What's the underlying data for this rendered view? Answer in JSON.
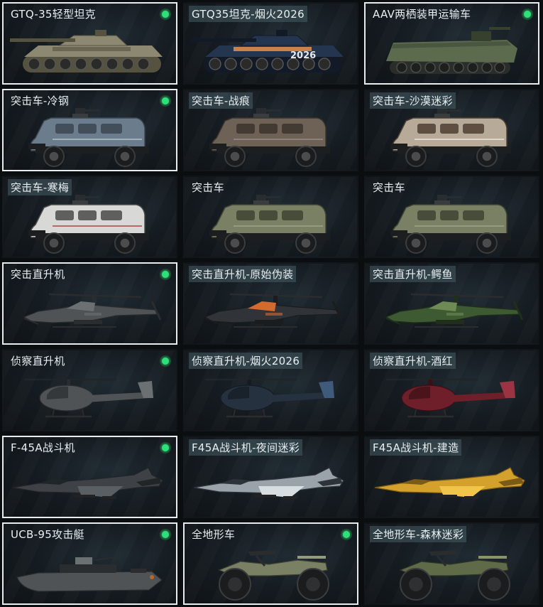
{
  "cards": [
    {
      "label": "GTQ-35轻型坦克",
      "type": "tank",
      "skin": "desert",
      "selected": true,
      "equipped": true,
      "tag": false
    },
    {
      "label": "GTQ35坦克-烟火2026",
      "type": "tank",
      "skin": "firework",
      "selected": false,
      "equipped": false,
      "tag": true,
      "decal": "2026"
    },
    {
      "label": "AAV两栖装甲运输车",
      "type": "aav",
      "skin": "green",
      "selected": true,
      "equipped": true,
      "tag": false
    },
    {
      "label": "突击车-冷钢",
      "type": "assault",
      "skin": "steel",
      "selected": true,
      "equipped": true,
      "tag": false
    },
    {
      "label": "突击车-战痕",
      "type": "assault",
      "skin": "battle",
      "selected": false,
      "equipped": false,
      "tag": true
    },
    {
      "label": "突击车-沙漠迷彩",
      "type": "assault",
      "skin": "desertcamo",
      "selected": false,
      "equipped": false,
      "tag": true
    },
    {
      "label": "突击车-寒梅",
      "type": "assault",
      "skin": "plum",
      "selected": false,
      "equipped": false,
      "tag": true
    },
    {
      "label": "突击车",
      "type": "assault",
      "skin": "olive",
      "selected": false,
      "equipped": false,
      "tag": false
    },
    {
      "label": "突击车",
      "type": "assault",
      "skin": "olive",
      "selected": false,
      "equipped": false,
      "tag": false
    },
    {
      "label": "突击直升机",
      "type": "attack_heli",
      "skin": "grey",
      "selected": true,
      "equipped": true,
      "tag": false
    },
    {
      "label": "突击直升机-原始伪装",
      "type": "attack_heli",
      "skin": "orange",
      "selected": false,
      "equipped": false,
      "tag": true
    },
    {
      "label": "突击直升机-鳄鱼",
      "type": "attack_heli",
      "skin": "croc",
      "selected": false,
      "equipped": false,
      "tag": true
    },
    {
      "label": "侦察直升机",
      "type": "scout_heli",
      "skin": "grey",
      "selected": false,
      "equipped": true,
      "tag": false
    },
    {
      "label": "侦察直升机-烟火2026",
      "type": "scout_heli",
      "skin": "navy",
      "selected": false,
      "equipped": false,
      "tag": true
    },
    {
      "label": "侦察直升机-酒红",
      "type": "scout_heli",
      "skin": "wine",
      "selected": false,
      "equipped": false,
      "tag": true
    },
    {
      "label": "F-45A战斗机",
      "type": "jet",
      "skin": "dark",
      "selected": true,
      "equipped": true,
      "tag": false
    },
    {
      "label": "F45A战斗机-夜间迷彩",
      "type": "jet",
      "skin": "nightcamo",
      "selected": false,
      "equipped": false,
      "tag": true
    },
    {
      "label": "F45A战斗机-建造",
      "type": "jet",
      "skin": "yellow",
      "selected": false,
      "equipped": false,
      "tag": true
    },
    {
      "label": "UCB-95攻击艇",
      "type": "boat",
      "skin": "grey",
      "selected": true,
      "equipped": true,
      "tag": false
    },
    {
      "label": "全地形车",
      "type": "atv",
      "skin": "olive",
      "selected": true,
      "equipped": true,
      "tag": false
    },
    {
      "label": "全地形车-森林迷彩",
      "type": "atv",
      "skin": "forest",
      "selected": false,
      "equipped": false,
      "tag": true
    }
  ],
  "skins": {
    "desert": {
      "main": "#8d8872",
      "dark": "#55523f",
      "accent": "#6b6652"
    },
    "firework": {
      "main": "#243550",
      "dark": "#121a28",
      "accent": "#c9824a"
    },
    "green": {
      "main": "#5c6a4e",
      "dark": "#36402d",
      "accent": "#4a5740"
    },
    "steel": {
      "main": "#6b7d8c",
      "dark": "#3b4751",
      "accent": "#9fb0bb"
    },
    "battle": {
      "main": "#6e6156",
      "dark": "#3b342d",
      "accent": "#8c8279"
    },
    "desertcamo": {
      "main": "#b8aa98",
      "dark": "#4e3f33",
      "accent": "#e0d6c9"
    },
    "plum": {
      "main": "#d8d8d6",
      "dark": "#4a4a48",
      "accent": "#b26a6a"
    },
    "olive": {
      "main": "#7a8064",
      "dark": "#3f4433",
      "accent": "#969b80"
    },
    "grey": {
      "main": "#4f5356",
      "dark": "#2a2d2f",
      "accent": "#6b7073"
    },
    "orange": {
      "main": "#303438",
      "dark": "#1a1c1e",
      "accent": "#d46a2e"
    },
    "croc": {
      "main": "#3d5a32",
      "dark": "#1f2f1a",
      "accent": "#6e8a55"
    },
    "navy": {
      "main": "#26313f",
      "dark": "#141b23",
      "accent": "#3f5a7a"
    },
    "wine": {
      "main": "#6e1f2a",
      "dark": "#3a0f16",
      "accent": "#9a3442"
    },
    "dark": {
      "main": "#3e4246",
      "dark": "#222528",
      "accent": "#5a5f63"
    },
    "nightcamo": {
      "main": "#9aa2aa",
      "dark": "#2e3338",
      "accent": "#d8dde1"
    },
    "yellow": {
      "main": "#d3a12c",
      "dark": "#7a5a15",
      "accent": "#f0c54a"
    },
    "forest": {
      "main": "#5e6a48",
      "dark": "#2e3524",
      "accent": "#8a9468"
    }
  }
}
